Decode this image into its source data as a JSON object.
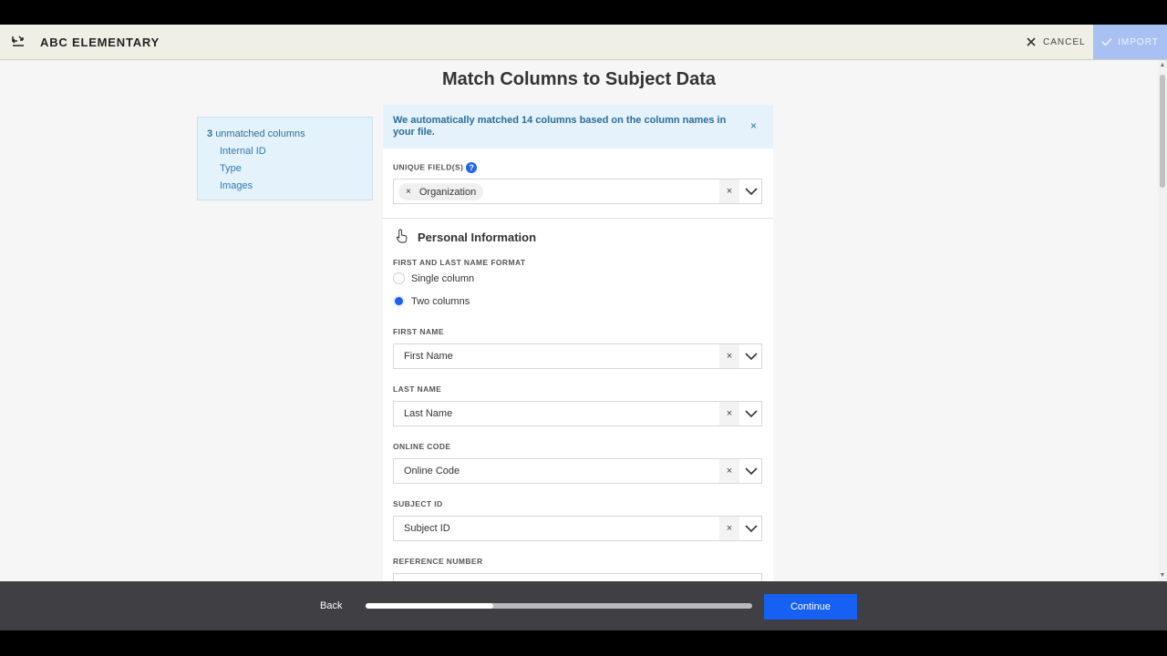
{
  "header": {
    "title": "ABC ELEMENTARY",
    "cancel_label": "CANCEL",
    "import_label": "IMPORT"
  },
  "page": {
    "title": "Match Columns to Subject Data"
  },
  "unmatched": {
    "count": "3",
    "label": "unmatched columns",
    "items": [
      "Internal ID",
      "Type",
      "Images"
    ]
  },
  "info": {
    "message": "We automatically matched 14 columns based on the column names in your file.",
    "close": "×"
  },
  "unique_fields": {
    "label": "UNIQUE FIELD(S)",
    "help": "?",
    "chips": [
      "Organization"
    ],
    "chip_remove": "×",
    "clear": "×"
  },
  "personal": {
    "title": "Personal Information",
    "name_format_label": "FIRST AND LAST NAME FORMAT",
    "options": [
      {
        "label": "Single column",
        "selected": false
      },
      {
        "label": "Two columns",
        "selected": true
      }
    ],
    "fields": [
      {
        "label": "FIRST NAME",
        "value": "First Name"
      },
      {
        "label": "LAST NAME",
        "value": "Last Name"
      },
      {
        "label": "ONLINE CODE",
        "value": "Online Code"
      },
      {
        "label": "SUBJECT ID",
        "value": "Subject ID"
      },
      {
        "label": "REFERENCE NUMBER",
        "value": ""
      }
    ],
    "clear": "×"
  },
  "footer": {
    "back_label": "Back",
    "continue_label": "Continue",
    "progress": 0.33
  },
  "colors": {
    "accent": "#1660f4",
    "info_bg": "#e5f2fb",
    "footer_bg": "#3f3f44"
  }
}
